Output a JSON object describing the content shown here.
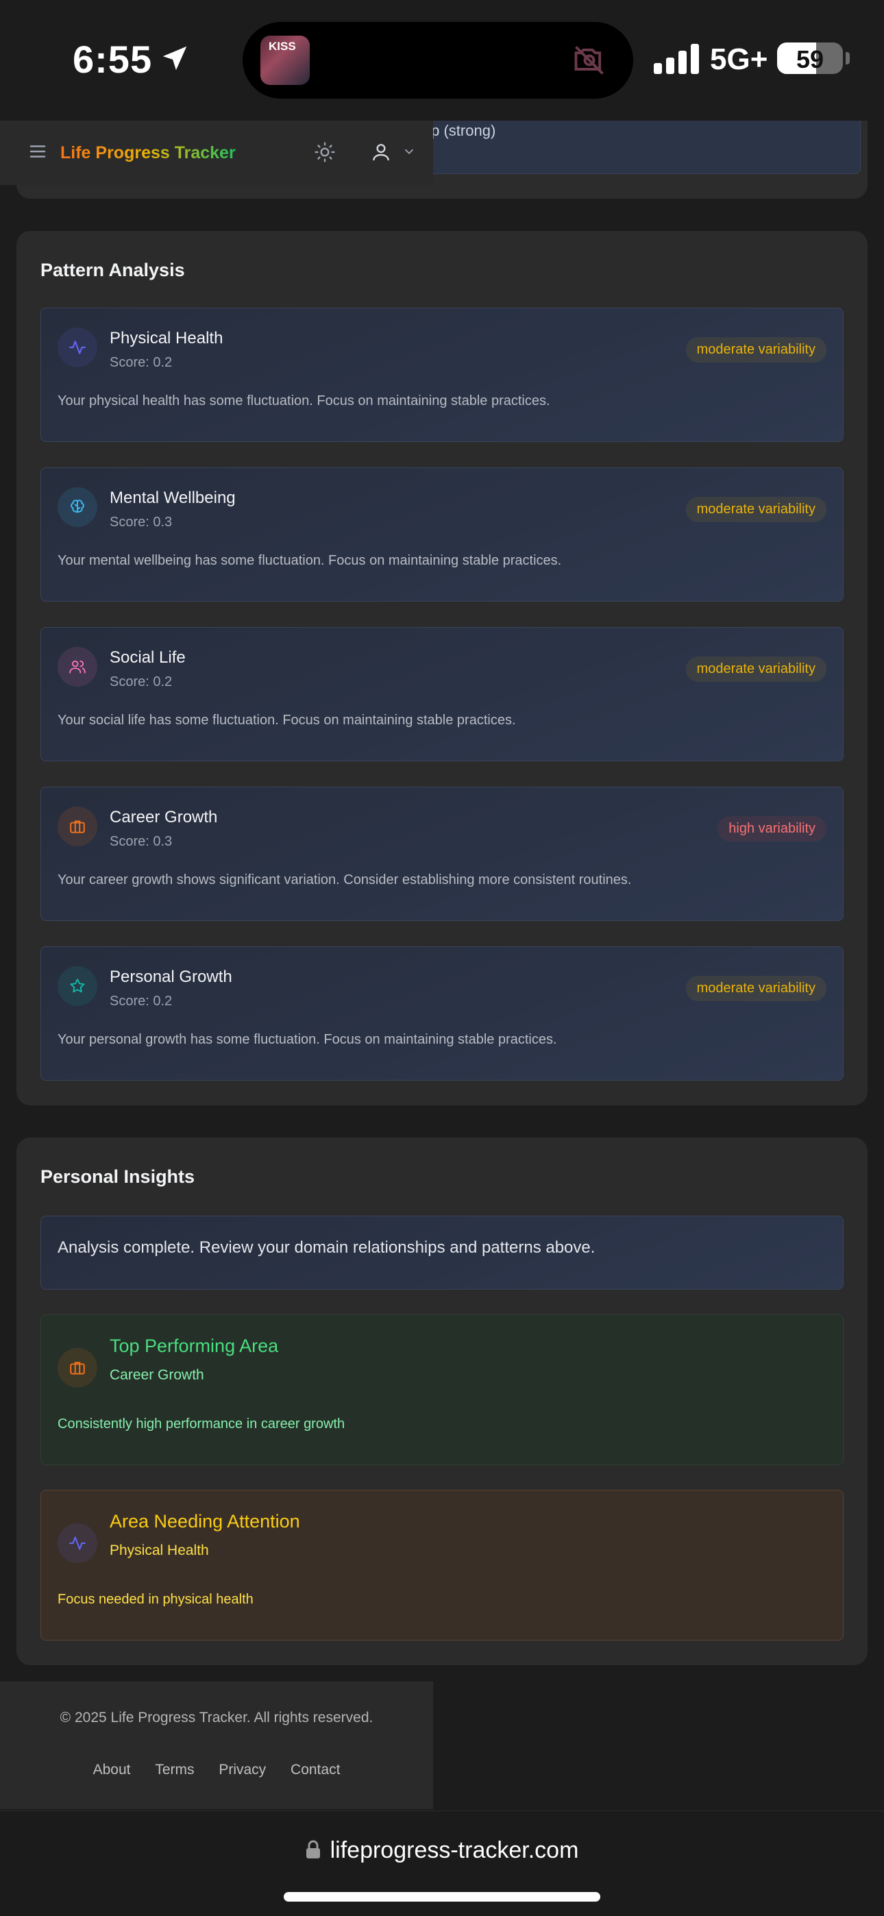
{
  "status_bar": {
    "time": "6:55",
    "network": "5G+",
    "battery": "59",
    "battery_level": 0.59,
    "island_art_text": "KISS"
  },
  "app": {
    "title": "Life Progress Tracker",
    "previous_card_text": "nip (strong)"
  },
  "pattern_analysis": {
    "title": "Pattern Analysis",
    "items": [
      {
        "icon": "activity-icon",
        "name": "Physical Health",
        "score": "Score: 0.2",
        "badge": "moderate variability",
        "level": "moderate",
        "desc": "Your physical health has some fluctuation. Focus on maintaining stable practices.",
        "color": "#6366f1"
      },
      {
        "icon": "brain-icon",
        "name": "Mental Wellbeing",
        "score": "Score: 0.3",
        "badge": "moderate variability",
        "level": "moderate",
        "desc": "Your mental wellbeing has some fluctuation. Focus on maintaining stable practices.",
        "color": "#38bdf8"
      },
      {
        "icon": "users-icon",
        "name": "Social Life",
        "score": "Score: 0.2",
        "badge": "moderate variability",
        "level": "moderate",
        "desc": "Your social life has some fluctuation. Focus on maintaining stable practices.",
        "color": "#f472b6"
      },
      {
        "icon": "briefcase-icon",
        "name": "Career Growth",
        "score": "Score: 0.3",
        "badge": "high variability",
        "level": "high",
        "desc": "Your career growth shows significant variation. Consider establishing more consistent routines.",
        "color": "#f97316"
      },
      {
        "icon": "star-icon",
        "name": "Personal Growth",
        "score": "Score: 0.2",
        "badge": "moderate variability",
        "level": "moderate",
        "desc": "Your personal growth has some fluctuation. Focus on maintaining stable practices.",
        "color": "#14b8a6"
      }
    ]
  },
  "personal_insights": {
    "title": "Personal Insights",
    "summary": "Analysis complete. Review your domain relationships and patterns above.",
    "top": {
      "title": "Top Performing Area",
      "area": "Career Growth",
      "desc": "Consistently high performance in career growth",
      "icon": "briefcase-icon"
    },
    "attention": {
      "title": "Area Needing Attention",
      "area": "Physical Health",
      "desc": "Focus needed in physical health",
      "icon": "activity-icon"
    }
  },
  "footer": {
    "copyright": "© 2025 Life Progress Tracker. All rights reserved.",
    "links": [
      "About",
      "Terms",
      "Privacy",
      "Contact"
    ]
  },
  "browser": {
    "url": "lifeprogress-tracker.com"
  }
}
